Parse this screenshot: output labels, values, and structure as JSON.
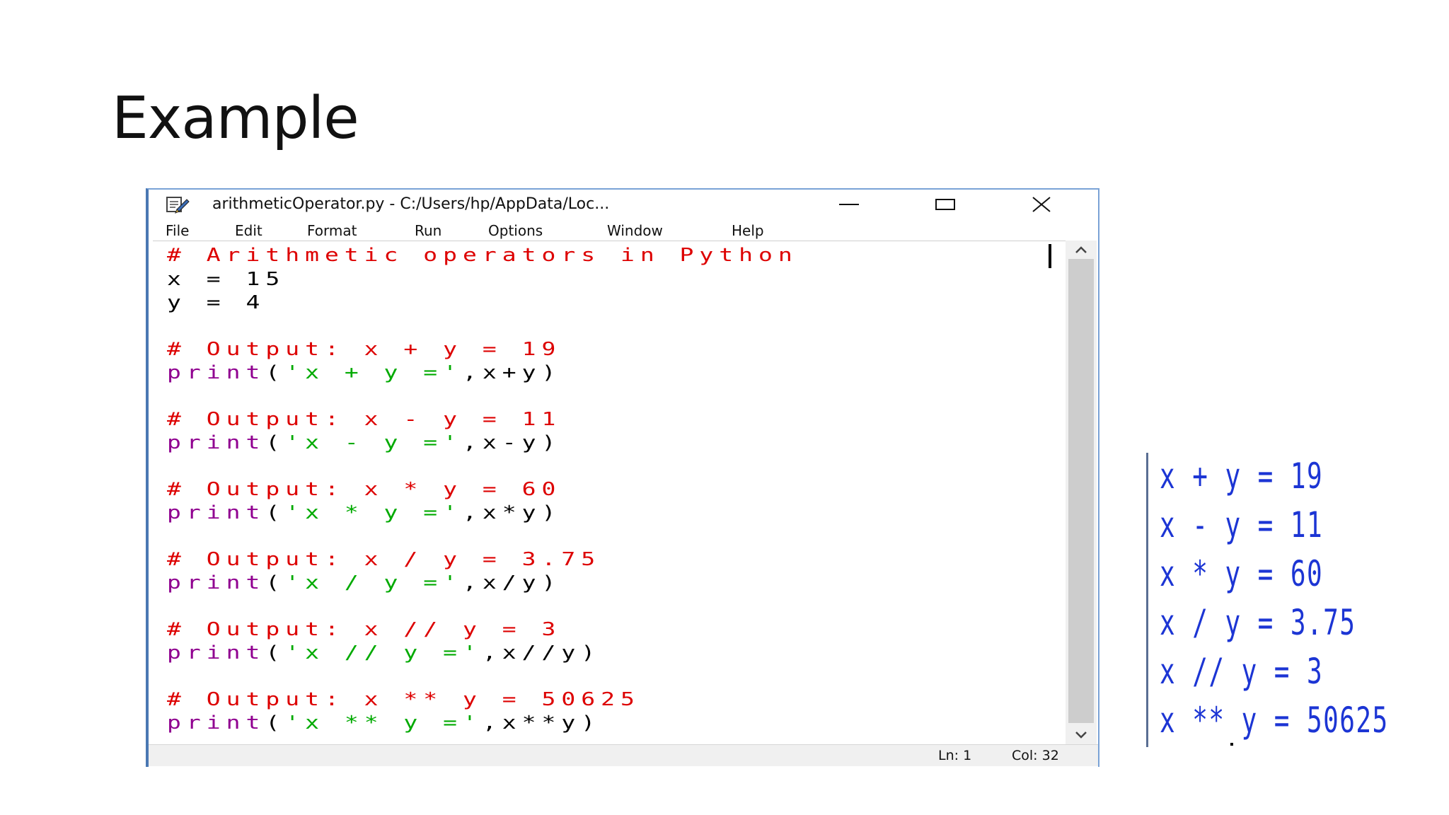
{
  "slide": {
    "title": "Example"
  },
  "window": {
    "title": "arithmeticOperator.py - C:/Users/hp/AppData/Loc...",
    "icons": {
      "app": "python-file-icon",
      "minimize": "minimize-icon",
      "maximize": "maximize-icon",
      "close": "close-icon"
    }
  },
  "menu": {
    "file": "File",
    "edit": "Edit",
    "format": "Format",
    "run": "Run",
    "options": "Options",
    "window": "Window",
    "help": "Help"
  },
  "code": {
    "line1": "# Arithmetic operators in Python",
    "line2": "x = 15",
    "line3": "y = 4",
    "comment1": "# Output: x + y = 19",
    "kw1": "print",
    "rest1a": "(",
    "str1": "'x + y ='",
    "rest1b": ",x+y)",
    "comment2": "# Output: x - y = 11",
    "kw2": "print",
    "rest2a": "(",
    "str2": "'x - y ='",
    "rest2b": ",x-y)",
    "comment3": "# Output: x * y = 60",
    "kw3": "print",
    "rest3a": "(",
    "str3": "'x * y ='",
    "rest3b": ",x*y)",
    "comment4": "# Output: x / y = 3.75",
    "kw4": "print",
    "rest4a": "(",
    "str4": "'x / y ='",
    "rest4b": ",x/y)",
    "comment5": "# Output: x // y = 3",
    "kw5": "print",
    "rest5a": "(",
    "str5": "'x // y ='",
    "rest5b": ",x//y)",
    "comment6": "# Output: x ** y = 50625",
    "kw6": "print",
    "rest6a": "(",
    "str6": "'x ** y ='",
    "rest6b": ",x**y)"
  },
  "colors": {
    "comment": "#dd0000",
    "keyword": "#900090",
    "string": "#00aa00",
    "plain": "#000000",
    "output": "#1c35d4"
  },
  "status": {
    "line": "Ln: 1",
    "col": "Col: 32"
  },
  "output": {
    "o1": "x + y = 19",
    "o2": "x - y = 11",
    "o3": "x * y = 60",
    "o4": "x / y = 3.75",
    "o5": "x // y = 3",
    "o6": "x ** y = 50625"
  }
}
